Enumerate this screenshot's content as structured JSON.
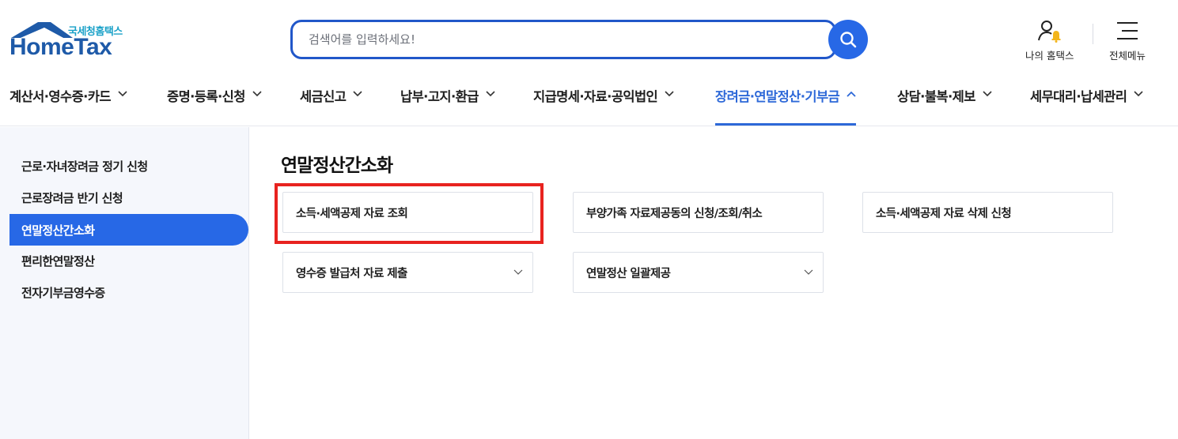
{
  "header": {
    "logo_sub": "국세청홈택스",
    "logo_main": "HomeTax",
    "search_placeholder": "검색어를 입력하세요!",
    "my_hometax_label": "나의 홈택스",
    "all_menu_label": "전체메뉴"
  },
  "gnb": {
    "items": [
      {
        "label": "계산서·영수증·카드",
        "active": false
      },
      {
        "label": "증명·등록·신청",
        "active": false
      },
      {
        "label": "세금신고",
        "active": false
      },
      {
        "label": "납부·고지·환급",
        "active": false
      },
      {
        "label": "지급명세·자료·공익법인",
        "active": false
      },
      {
        "label": "장려금·연말정산·기부금",
        "active": true
      },
      {
        "label": "상담·불복·제보",
        "active": false
      },
      {
        "label": "세무대리·납세관리",
        "active": false
      }
    ]
  },
  "sidebar": {
    "items": [
      {
        "label": "근로·자녀장려금 정기 신청",
        "active": false
      },
      {
        "label": "근로장려금 반기 신청",
        "active": false
      },
      {
        "label": "연말정산간소화",
        "active": true
      },
      {
        "label": "편리한연말정산",
        "active": false
      },
      {
        "label": "전자기부금영수증",
        "active": false
      }
    ]
  },
  "main": {
    "title": "연말정산간소화",
    "cards": [
      {
        "label": "소득·세액공제 자료 조회",
        "has_dropdown": false
      },
      {
        "label": "부양가족 자료제공동의 신청/조회/취소",
        "has_dropdown": false
      },
      {
        "label": "소득·세액공제 자료 삭제 신청",
        "has_dropdown": false
      },
      {
        "label": "영수증 발급처 자료 제출",
        "has_dropdown": true
      },
      {
        "label": "연말정산 일괄제공",
        "has_dropdown": true
      }
    ]
  },
  "colors": {
    "brand_blue": "#2768e6",
    "active_text": "#2d68d8",
    "highlight_red": "#e8231f"
  }
}
